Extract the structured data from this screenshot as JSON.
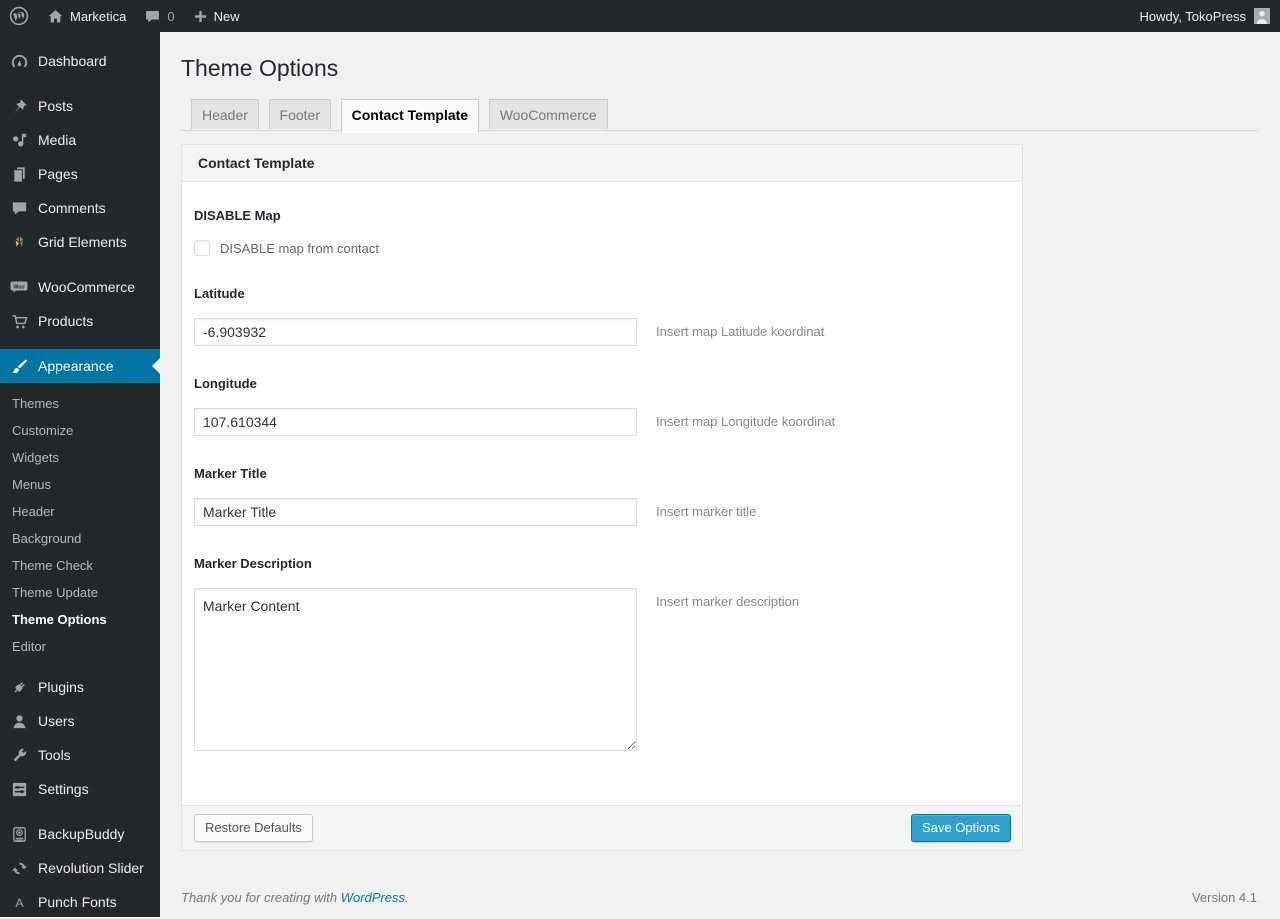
{
  "colors": {
    "admin_dark": "#23282d",
    "accent_active": "#0074a2",
    "button_primary": "#2ea2cc",
    "link": "#0074a2",
    "page_background": "#f1f1f1"
  },
  "admin_bar": {
    "site_name": "Marketica",
    "comment_count": "0",
    "new_label": "New",
    "howdy": "Howdy, TokoPress"
  },
  "sidebar": {
    "top": [
      "Dashboard",
      "Posts",
      "Media",
      "Pages",
      "Comments",
      "Grid Elements"
    ],
    "commerce": [
      "WooCommerce",
      "Products"
    ],
    "appearance": "Appearance",
    "appearance_submenu": [
      "Themes",
      "Customize",
      "Widgets",
      "Menus",
      "Header",
      "Background",
      "Theme Check",
      "Theme Update",
      "Theme Options",
      "Editor"
    ],
    "lower": [
      "Plugins",
      "Users",
      "Tools",
      "Settings"
    ],
    "extras": [
      "BackupBuddy",
      "Revolution Slider",
      "Punch Fonts"
    ]
  },
  "page": {
    "title": "Theme Options",
    "tabs": [
      "Header",
      "Footer",
      "Contact Template",
      "WooCommerce"
    ],
    "active_tab": "Contact Template"
  },
  "panel": {
    "header": "Contact Template",
    "disable_map": {
      "label": "DISABLE Map",
      "checkbox_label": "DISABLE map from contact",
      "checked": false
    },
    "latitude": {
      "label": "Latitude",
      "value": "-6.903932",
      "hint": "Insert map Latitude koordinat"
    },
    "longitude": {
      "label": "Longitude",
      "value": "107.610344",
      "hint": "Insert map Longitude koordinat"
    },
    "marker_title": {
      "label": "Marker Title",
      "value": "Marker Title",
      "hint": "Insert marker title"
    },
    "marker_description": {
      "label": "Marker Description",
      "value": "Marker Content",
      "hint": "Insert marker description"
    },
    "restore_button": "Restore Defaults",
    "save_button": "Save Options"
  },
  "footer": {
    "thanks_text": "Thank you for creating with ",
    "wordpress_link": "WordPress",
    "period": ".",
    "version": "Version 4.1"
  }
}
